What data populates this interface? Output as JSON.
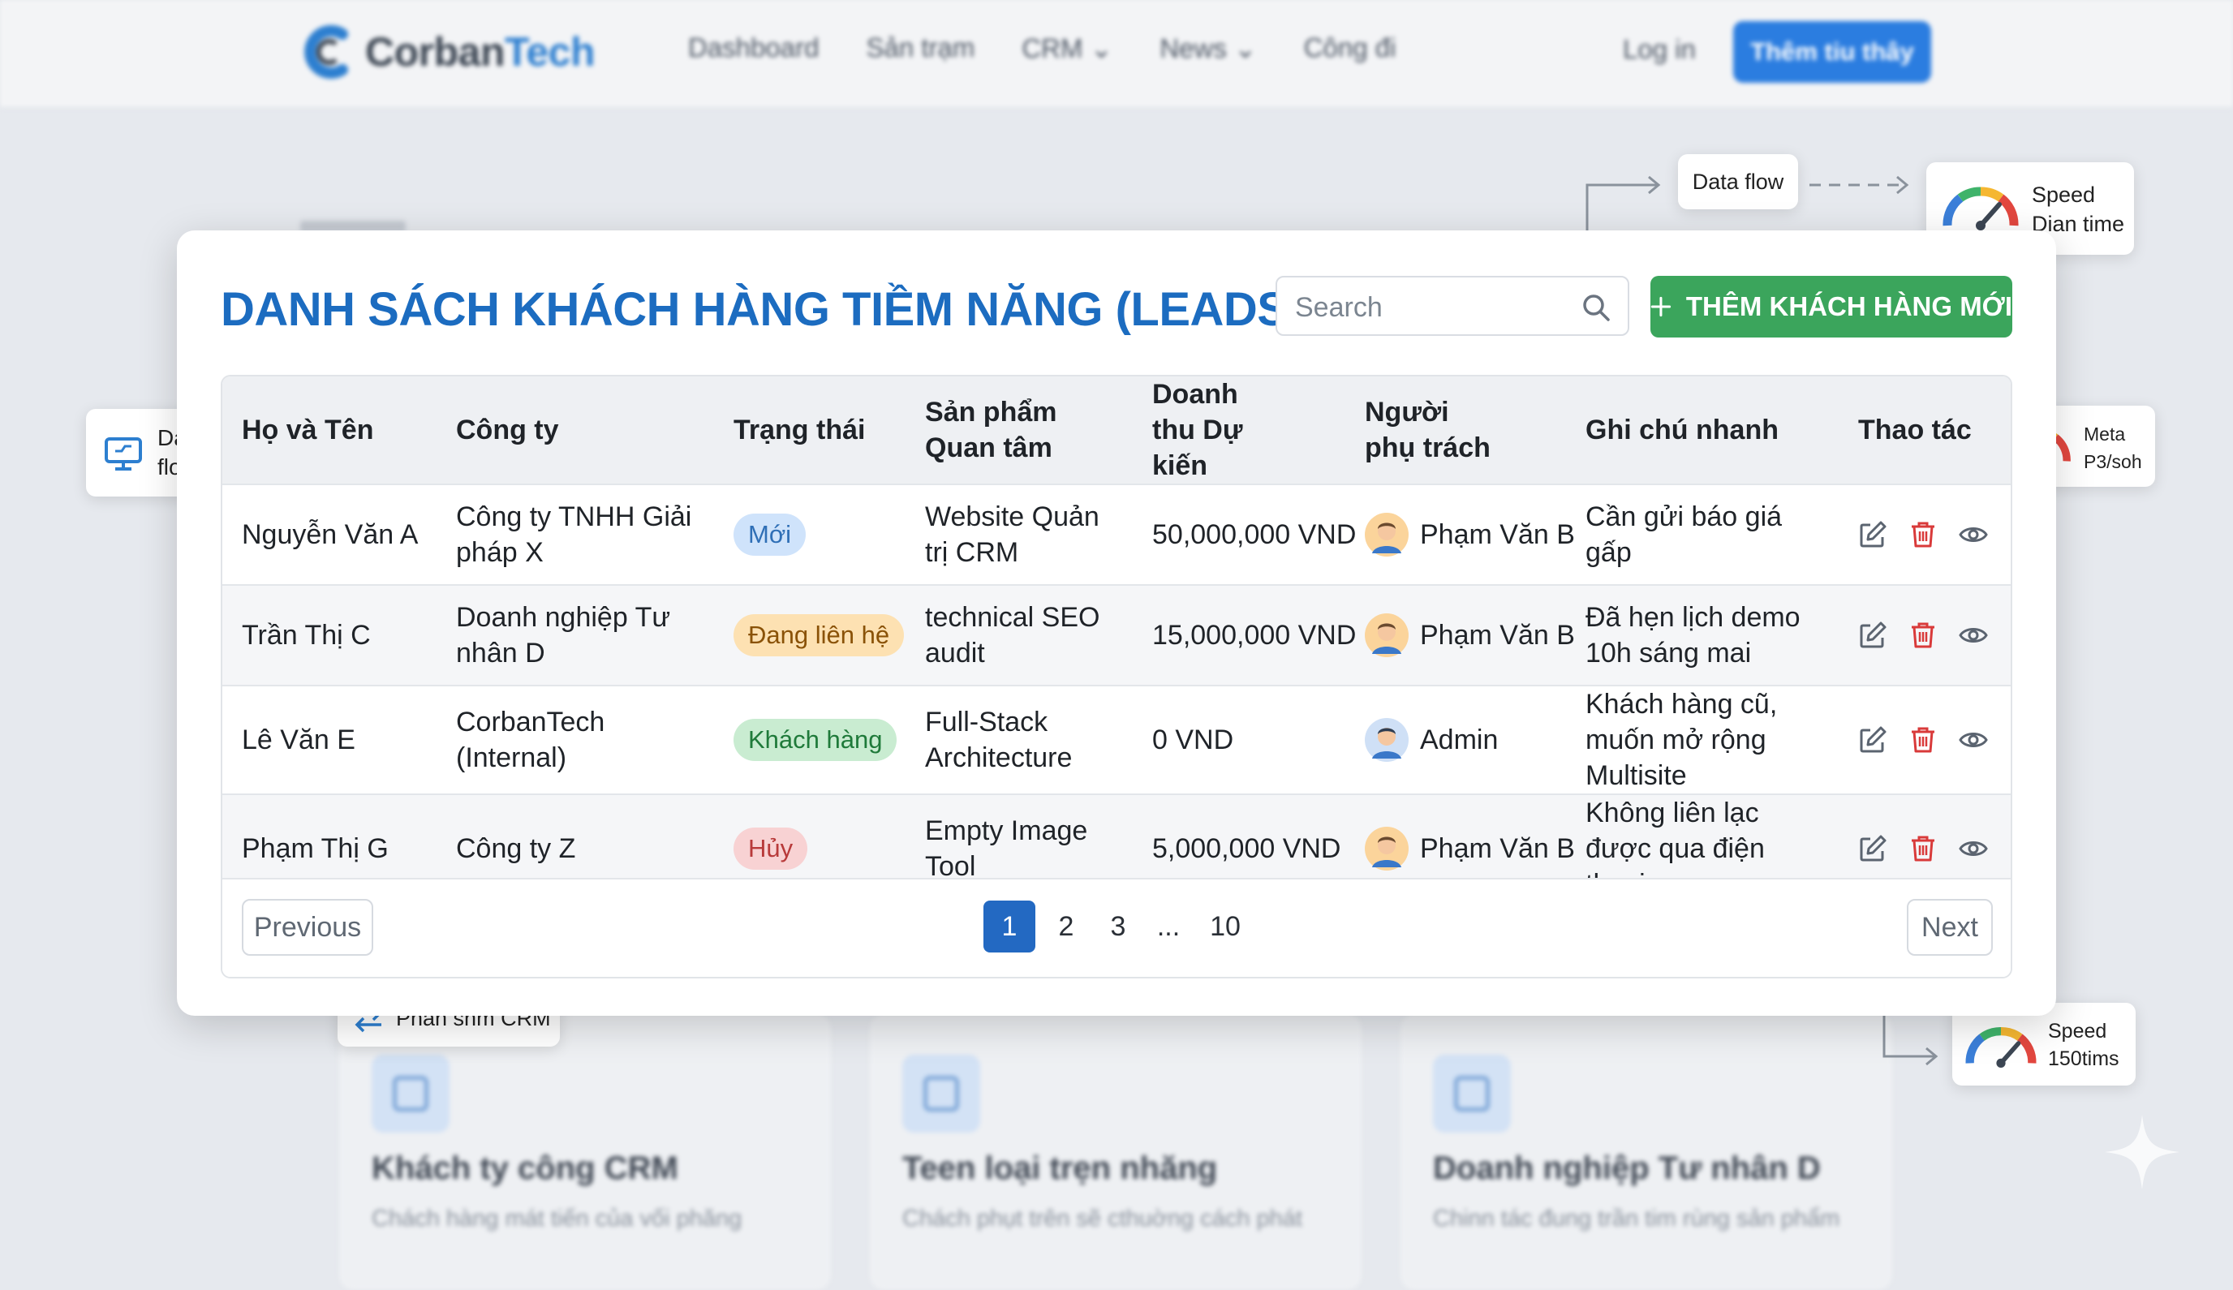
{
  "nav": {
    "logo_part1": "Corban",
    "logo_part2": "Tech",
    "links": [
      "Dashboard",
      "Sản trạm",
      "CRM",
      "News",
      "Công đi"
    ],
    "login": "Log in",
    "cta": "Thêm tiu thây"
  },
  "chips": {
    "data_flows": "Data flows",
    "data_flow": "Data flow",
    "speed_top_line1": "Speed",
    "speed_top_line2": "Dian time",
    "meta_line1": "Meta",
    "meta_line2": "P3/soh",
    "crm_link": "Phấn shm CRM",
    "speed_bottom_line1": "Speed",
    "speed_bottom_line2": "150tims"
  },
  "panel": {
    "title": "DANH SÁCH KHÁCH HÀNG TIỀM NĂNG (LEADS)",
    "search_placeholder": "Search",
    "add_button": "THÊM KHÁCH HÀNG MỚI"
  },
  "table": {
    "headers": [
      "Họ và Tên",
      "Công ty",
      "Trạng thái",
      "Sản phẩm Quan tâm",
      "Doanh thu Dự kiến",
      "Người phụ trách",
      "Ghi chú nhanh",
      "Thao tác"
    ],
    "rows": [
      {
        "name": "Nguyễn Văn A",
        "company": "Công ty TNHH Giải pháp X",
        "status": "Mới",
        "product": "Website Quản trị CRM",
        "revenue": "50,000,000 VND",
        "owner": "Phạm Văn B",
        "note": "Cần gửi báo giá gấp"
      },
      {
        "name": "Trần Thị C",
        "company": "Doanh nghiệp Tư nhân D",
        "status": "Đang liên hệ",
        "product": "technical SEO audit",
        "revenue": "15,000,000 VND",
        "owner": "Phạm Văn B",
        "note": "Đã hẹn lịch demo 10h sáng mai"
      },
      {
        "name": "Lê Văn E",
        "company": "CorbanTech (Internal)",
        "status": "Khách hàng",
        "product": "Full-Stack Architecture",
        "revenue": "0 VND",
        "owner": "Admin",
        "note": "Khách hàng cũ, muốn mở rộng Multisite"
      },
      {
        "name": "Phạm Thị G",
        "company": "Công ty Z",
        "status": "Hủy",
        "product": "Empty Image Tool",
        "revenue": "5,000,000 VND",
        "owner": "Phạm Văn B",
        "note": "Không liên lạc được qua điện thoại"
      }
    ],
    "status_colors": {
      "Mới": "#cfe3fb",
      "Đang liên hệ": "#fde1b2",
      "Khách hàng": "#c9ecd1",
      "Hủy": "#f8d2d3"
    },
    "status_text_colors": {
      "Mới": "#2f6fb6",
      "Đang liên hệ": "#8a5207",
      "Khách hàng": "#1f7a3a",
      "Hủy": "#b83a3a"
    }
  },
  "pagination": {
    "previous": "Previous",
    "next": "Next",
    "pages": [
      "1",
      "2",
      "3",
      "...",
      "10"
    ],
    "current": "1"
  },
  "background_cards": [
    {
      "title": "Khách ty công CRM",
      "text": "Chách hàng mát tiến của vối phăng"
    },
    {
      "title": "Teen loại trẹn nhăng",
      "text": "Chách phụt trên sẽ cthuờng cách phát"
    },
    {
      "title": "Doanh nghiệp Tư nhân D",
      "text": "Chinn tác đung trần tim rùng sản phẩm"
    }
  ],
  "colors": {
    "title_blue": "#1c6cc0",
    "add_green": "#3ba55c",
    "active_page": "#2369c2",
    "action_red": "#d93a3a",
    "action_gray": "#5b6470"
  }
}
